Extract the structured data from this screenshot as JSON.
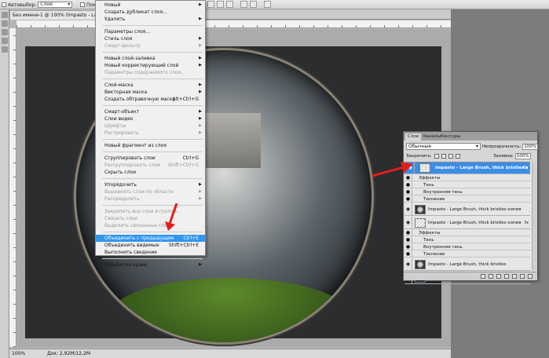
{
  "options_bar": {
    "autoselect_label": "Автовыбор:",
    "autoselect_value": "Слой",
    "show_label": "Показ"
  },
  "document": {
    "tab_title": "Без имени-1 @ 100% (Impasto - Large Brush, thick bristles копия 2, RGB/8)",
    "zoom": "100%",
    "doc_info": "Док: 2,92M/12,2M"
  },
  "context_menu": {
    "items": [
      {
        "label": "Новый",
        "shortcut": "",
        "submenu": true,
        "disabled": false
      },
      {
        "label": "Создать дубликат слоя...",
        "shortcut": "",
        "submenu": false,
        "disabled": false
      },
      {
        "label": "Удалить",
        "shortcut": "",
        "submenu": true,
        "disabled": false
      },
      {
        "label": "Параметры слоя...",
        "shortcut": "",
        "submenu": false,
        "disabled": false
      },
      {
        "label": "Стиль слоя",
        "shortcut": "",
        "submenu": true,
        "disabled": false
      },
      {
        "label": "Смарт-фильтр",
        "shortcut": "",
        "submenu": true,
        "disabled": true
      },
      {
        "label": "Новый слой-заливка",
        "shortcut": "",
        "submenu": true,
        "disabled": false
      },
      {
        "label": "Новый корректирующий слой",
        "shortcut": "",
        "submenu": true,
        "disabled": false
      },
      {
        "label": "Параметры содержимого слоя...",
        "shortcut": "",
        "submenu": false,
        "disabled": true
      },
      {
        "label": "Слой-маска",
        "shortcut": "",
        "submenu": true,
        "disabled": false
      },
      {
        "label": "Векторная маска",
        "shortcut": "",
        "submenu": true,
        "disabled": false
      },
      {
        "label": "Создать обтравочную маску",
        "shortcut": "Alt+Ctrl+G",
        "submenu": false,
        "disabled": false
      },
      {
        "label": "Смарт-объект",
        "shortcut": "",
        "submenu": true,
        "disabled": false
      },
      {
        "label": "Слои видео",
        "shortcut": "",
        "submenu": true,
        "disabled": false
      },
      {
        "label": "Шрифты",
        "shortcut": "",
        "submenu": true,
        "disabled": true
      },
      {
        "label": "Растрировать",
        "shortcut": "",
        "submenu": true,
        "disabled": true
      },
      {
        "label": "Новый фрагмент из слоя",
        "shortcut": "",
        "submenu": false,
        "disabled": false
      },
      {
        "label": "Сгруппировать слои",
        "shortcut": "Ctrl+G",
        "submenu": false,
        "disabled": false
      },
      {
        "label": "Разгруппировать слои",
        "shortcut": "Shift+Ctrl+G",
        "submenu": false,
        "disabled": true
      },
      {
        "label": "Скрыть слои",
        "shortcut": "",
        "submenu": false,
        "disabled": false
      },
      {
        "label": "Упорядочить",
        "shortcut": "",
        "submenu": true,
        "disabled": false
      },
      {
        "label": "Выровнять слои по области",
        "shortcut": "",
        "submenu": true,
        "disabled": true
      },
      {
        "label": "Распределить",
        "shortcut": "",
        "submenu": true,
        "disabled": true
      },
      {
        "label": "Закрепить все слои в группе...",
        "shortcut": "",
        "submenu": false,
        "disabled": true
      },
      {
        "label": "Связать слои",
        "shortcut": "",
        "submenu": false,
        "disabled": true
      },
      {
        "label": "Выделить связанные слои",
        "shortcut": "",
        "submenu": false,
        "disabled": true
      },
      {
        "label": "Объединить с предыдущим",
        "shortcut": "Ctrl+E",
        "submenu": false,
        "disabled": false,
        "highlighted": true
      },
      {
        "label": "Объединить видимые",
        "shortcut": "Shift+Ctrl+E",
        "submenu": false,
        "disabled": false
      },
      {
        "label": "Выполнить сведение",
        "shortcut": "",
        "submenu": false,
        "disabled": false
      },
      {
        "label": "Обработка краев",
        "shortcut": "",
        "submenu": true,
        "disabled": false
      }
    ]
  },
  "layers_panel": {
    "tabs": [
      "Слои",
      "Каналы",
      "Контуры"
    ],
    "blend_mode": "Обычные",
    "opacity_label": "Непрозрачность:",
    "opacity_value": "100%",
    "lock_label": "Закрепить:",
    "fill_label": "Заливка:",
    "fill_value": "100%",
    "layers": [
      {
        "name": "Impasto - Large Brush, thick bristles копия 2",
        "thumb": "checker",
        "selected": true,
        "fx": true
      },
      {
        "name": "Эффекты",
        "type": "effects"
      },
      {
        "name": "Тень",
        "type": "effect"
      },
      {
        "name": "Внутренняя тень",
        "type": "effect"
      },
      {
        "name": "Тиснение",
        "type": "effect"
      },
      {
        "name": "Impasto - Large Brush, thick bristles копия 2",
        "thumb": "ball",
        "selected": false,
        "fx": false
      },
      {
        "name": "Impasto - Large Brush, thick bristles копия",
        "thumb": "checker",
        "selected": false,
        "fx": true
      },
      {
        "name": "Эффекты",
        "type": "effects"
      },
      {
        "name": "Тень",
        "type": "effect"
      },
      {
        "name": "Внутренняя тень",
        "type": "effect"
      },
      {
        "name": "Тиснение",
        "type": "effect"
      },
      {
        "name": "Impasto - Large Brush, thick bristles",
        "thumb": "ball",
        "selected": false,
        "fx": false
      },
      {
        "name": "Слой 1",
        "thumb": "dark",
        "selected": false,
        "fx": false
      }
    ]
  },
  "colors": {
    "accent": "#3296f0",
    "arrow": "#e0201a",
    "canvas": "#2b2d2f"
  }
}
